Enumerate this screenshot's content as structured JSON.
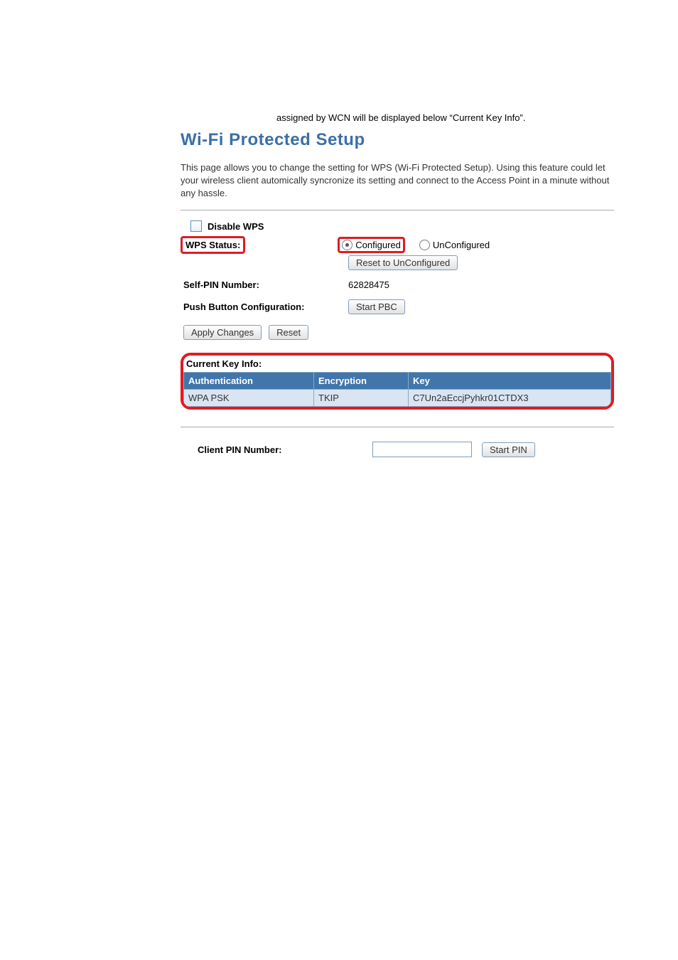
{
  "intro": "assigned by WCN will be displayed below “Current Key Info”.",
  "title": "Wi-Fi Protected Setup",
  "description": "This page allows you to change the setting for WPS (Wi-Fi Protected Setup). Using this feature could let your wireless client automically syncronize its setting and connect to the Access Point in a minute without any hassle.",
  "disable_wps_label": "Disable WPS",
  "wps_status": {
    "label": "WPS Status:",
    "option_configured": "Configured",
    "option_unconfigured": "UnConfigured",
    "selected": "configured"
  },
  "reset_unconfigured_btn": "Reset to UnConfigured",
  "self_pin": {
    "label": "Self-PIN Number:",
    "value": "62828475"
  },
  "pbc": {
    "label": "Push Button Configuration:",
    "button": "Start PBC"
  },
  "apply_btn": "Apply Changes",
  "reset_btn": "Reset",
  "key_info": {
    "title": "Current Key Info:",
    "headers": {
      "auth": "Authentication",
      "enc": "Encryption",
      "key": "Key"
    },
    "row": {
      "auth": "WPA PSK",
      "enc": "TKIP",
      "key": "C7Un2aEccjPyhkr01CTDX3"
    }
  },
  "client_pin": {
    "label": "Client PIN Number:",
    "value": "",
    "button": "Start PIN"
  }
}
